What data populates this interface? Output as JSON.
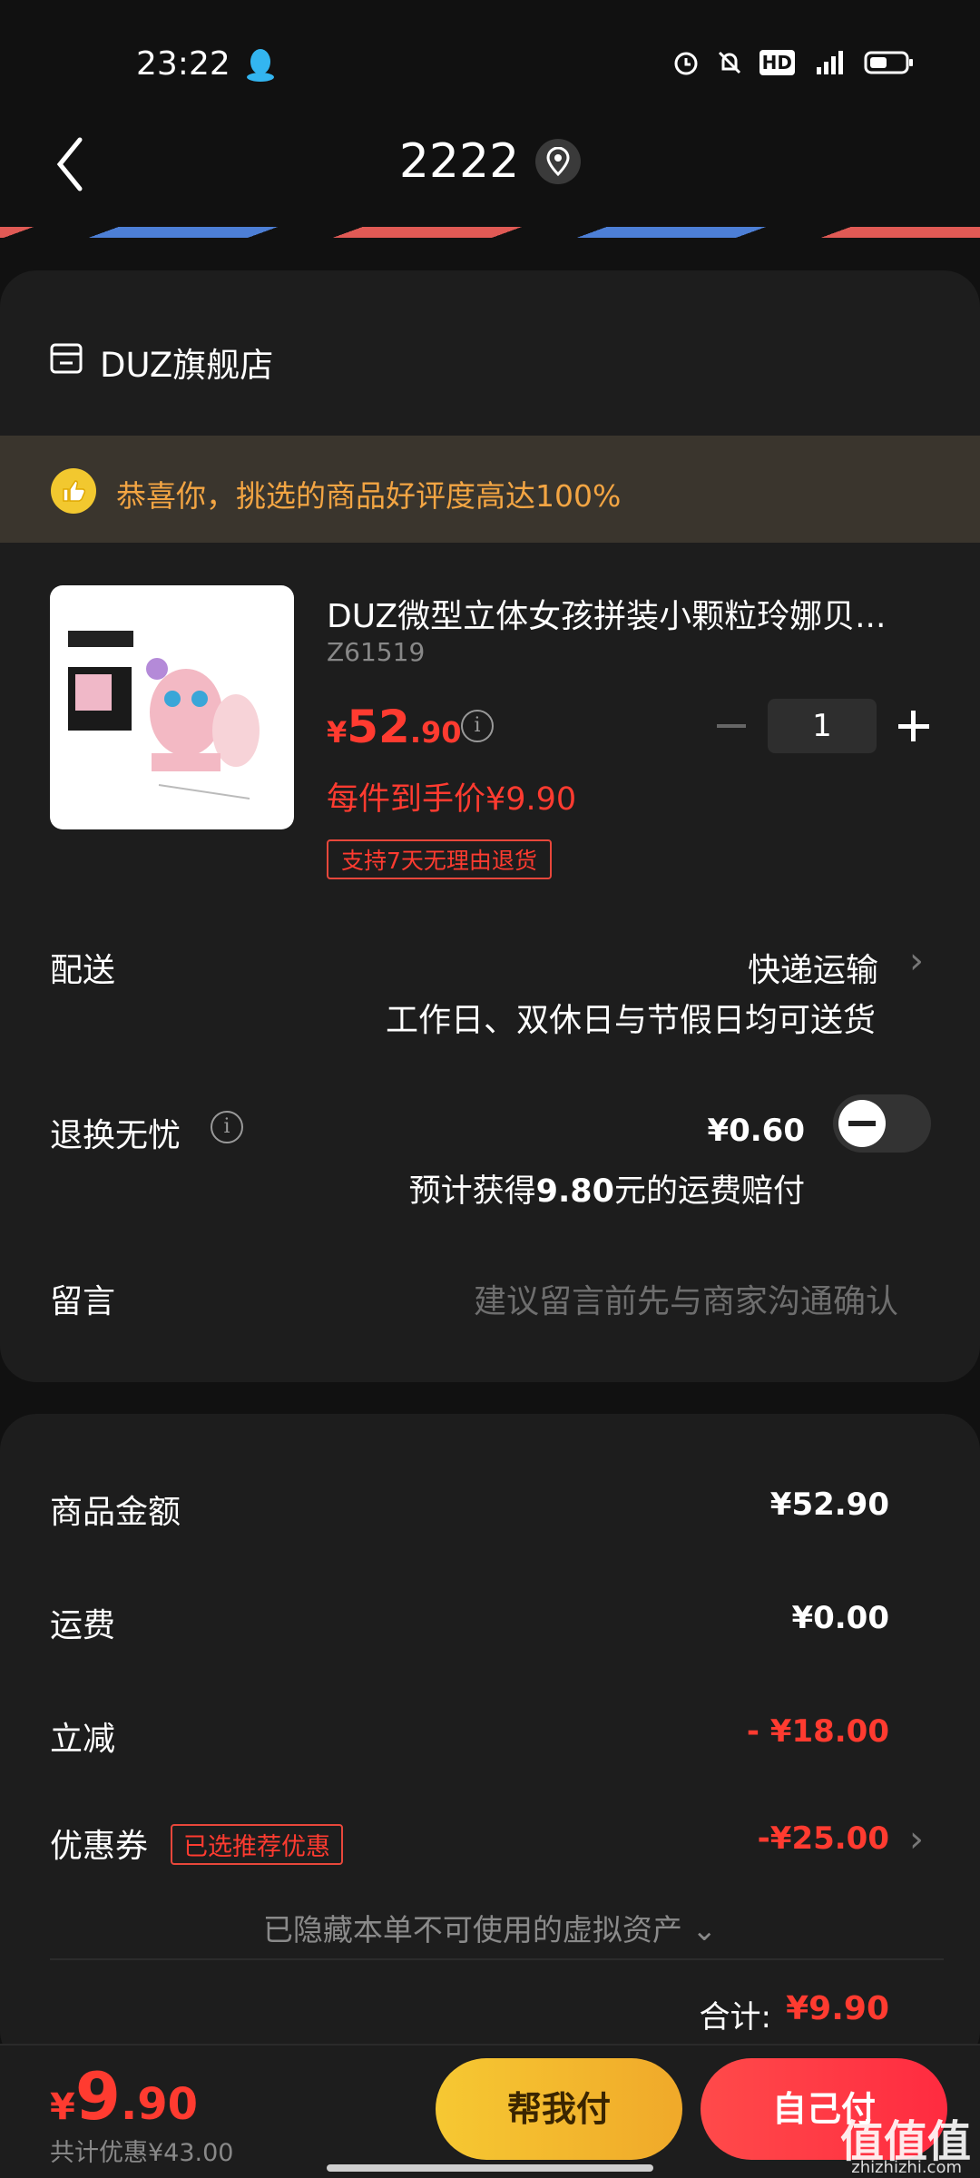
{
  "status_bar": {
    "time": "23:22",
    "icons": [
      "qq-icon",
      "alarm-icon",
      "mute-icon",
      "hd-icon",
      "5g-signal-icon",
      "battery-icon"
    ],
    "hd": "HD"
  },
  "header": {
    "title": "2222"
  },
  "store": {
    "name": "DUZ旗舰店"
  },
  "banner": {
    "text": "恭喜你，挑选的商品好评度高达100%"
  },
  "product": {
    "name": "DUZ微型立体女孩拼装小颗粒玲娜贝...",
    "code": "Z61519",
    "price_symbol": "¥",
    "price_int": "52",
    "price_dec": ".90",
    "quantity": "1",
    "unit_price": "每件到手价¥9.90",
    "return_tag": "支持7天无理由退货"
  },
  "delivery": {
    "label": "配送",
    "method": "快递运输",
    "note": "工作日、双休日与节假日均可送货"
  },
  "return_insurance": {
    "label": "退换无忧",
    "price": "¥0.60",
    "note_prefix": "预计获得",
    "note_amount": "9.80",
    "note_suffix": "元的运费赔付"
  },
  "message": {
    "label": "留言",
    "placeholder": "建议留言前先与商家沟通确认"
  },
  "summary": {
    "goods_label": "商品金额",
    "goods_value": "¥52.90",
    "shipping_label": "运费",
    "shipping_value": "¥0.00",
    "discount_label": "立减",
    "discount_value": "- ¥18.00",
    "coupon_label": "优惠券",
    "coupon_tag": "已选推荐优惠",
    "coupon_value": "-¥25.00",
    "hidden_note": "已隐藏本单不可使用的虚拟资产",
    "total_label": "合计:",
    "total_value": "¥9.90"
  },
  "bottom": {
    "price_symbol": "¥",
    "price_int": "9",
    "price_dec": ".90",
    "saved": "共计优惠¥43.00",
    "friend_pay": "帮我付",
    "self_pay": "自己付"
  },
  "watermark": {
    "text": "值值值",
    "url": "zhizhizhi.com"
  },
  "colors": {
    "accent_red": "#ff3b30",
    "banner_orange": "#f3a543",
    "friend_button": "#f6c832",
    "self_button": "#ff2b40"
  }
}
